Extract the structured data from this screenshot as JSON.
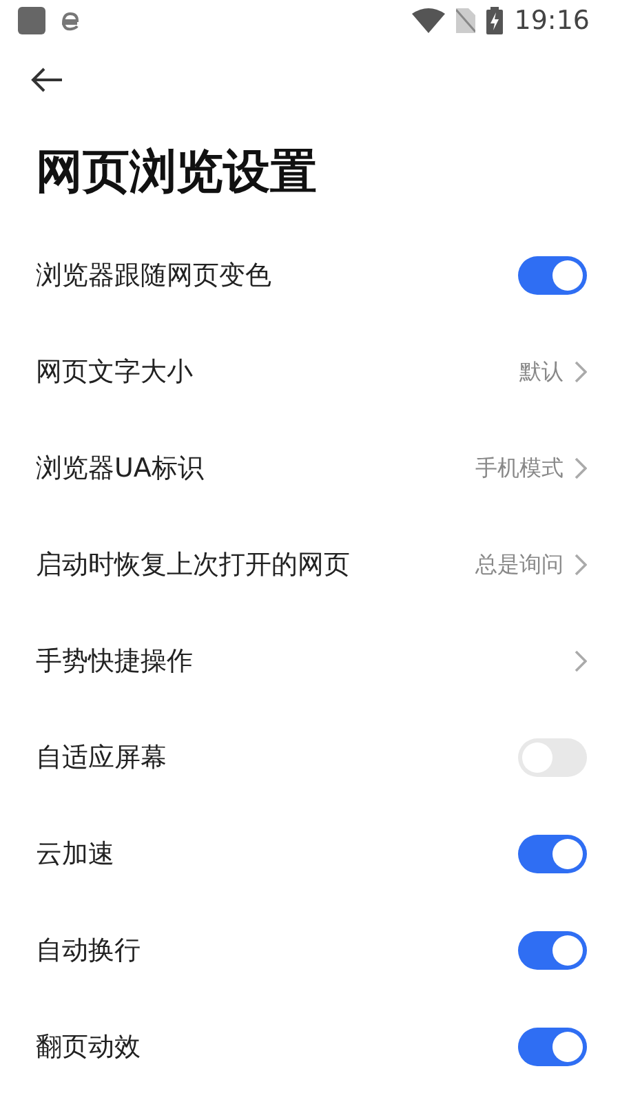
{
  "status_bar": {
    "time": "19:16"
  },
  "title": "网页浏览设置",
  "settings": [
    {
      "label": "浏览器跟随网页变色",
      "kind": "toggle",
      "on": true
    },
    {
      "label": "网页文字大小",
      "kind": "link",
      "value": "默认"
    },
    {
      "label": "浏览器UA标识",
      "kind": "link",
      "value": "手机模式"
    },
    {
      "label": "启动时恢复上次打开的网页",
      "kind": "link",
      "value": "总是询问"
    },
    {
      "label": "手势快捷操作",
      "kind": "link"
    },
    {
      "label": "自适应屏幕",
      "kind": "toggle",
      "on": false
    },
    {
      "label": "云加速",
      "kind": "toggle",
      "on": true
    },
    {
      "label": "自动换行",
      "kind": "toggle",
      "on": true
    },
    {
      "label": "翻页动效",
      "kind": "toggle",
      "on": true
    }
  ]
}
